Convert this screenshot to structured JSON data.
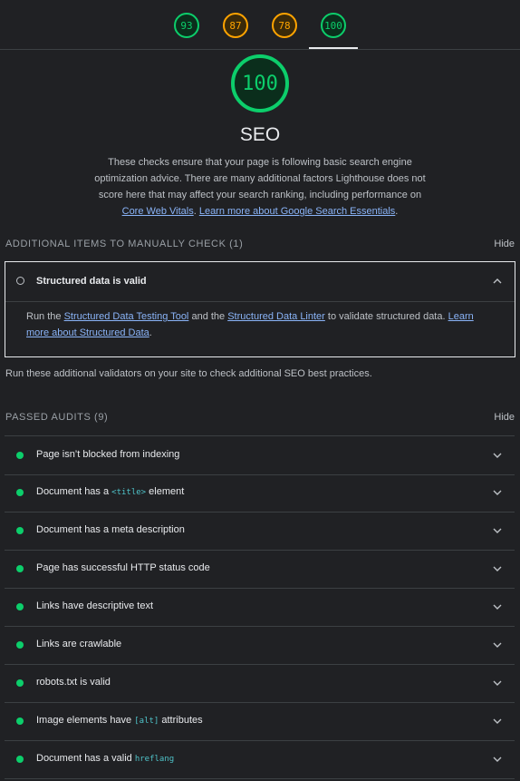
{
  "score_tabs": [
    {
      "score": "93",
      "color": "#0cce6b"
    },
    {
      "score": "87",
      "color": "#ffa400"
    },
    {
      "score": "78",
      "color": "#ffa400"
    },
    {
      "score": "100",
      "color": "#0cce6b",
      "active": true
    }
  ],
  "category": {
    "score": "100",
    "title": "SEO",
    "description_text": "These checks ensure that your page is following basic search engine optimization advice. There are many additional factors Lighthouse does not score here that may affect your search ranking, including performance on",
    "link1": "Core Web Vitals",
    "sep": ".",
    "link2": "Learn more about Google Search Essentials",
    "end": "."
  },
  "manual": {
    "group_title": "Additional items to manually check (1)",
    "hide_label": "Hide",
    "item_title": "Structured data is valid",
    "body": {
      "t1": "Run the",
      "l1": "Structured Data Testing Tool",
      "t2": "and the",
      "l2": "Structured Data Linter",
      "t3": "to validate structured data.",
      "l3": "Learn more about Structured Data",
      "t4": "."
    },
    "note": "Run these additional validators on your site to check additional SEO best practices."
  },
  "passed": {
    "group_title": "Passed audits (9)",
    "hide_label": "Hide",
    "audits": [
      {
        "pre": "Page isn’t blocked from indexing",
        "code": "",
        "post": ""
      },
      {
        "pre": "Document has a ",
        "code": "<title>",
        "post": " element"
      },
      {
        "pre": "Document has a meta description",
        "code": "",
        "post": ""
      },
      {
        "pre": "Page has successful HTTP status code",
        "code": "",
        "post": ""
      },
      {
        "pre": "Links have descriptive text",
        "code": "",
        "post": ""
      },
      {
        "pre": "Links are crawlable",
        "code": "",
        "post": ""
      },
      {
        "pre": "robots.txt is valid",
        "code": "",
        "post": ""
      },
      {
        "pre": "Image elements have ",
        "code": "[alt]",
        "post": " attributes"
      },
      {
        "pre": "Document has a valid ",
        "code": "hreflang",
        "post": ""
      }
    ]
  },
  "colors": {
    "pass": "#0cce6b",
    "average": "#ffa400",
    "background": "#202124",
    "link": "#8ab4f8"
  },
  "icons": {
    "expand": "chevron-down-icon",
    "collapse": "chevron-up-icon",
    "manual": "circle-outline-icon",
    "pass": "pass-dot-icon"
  }
}
